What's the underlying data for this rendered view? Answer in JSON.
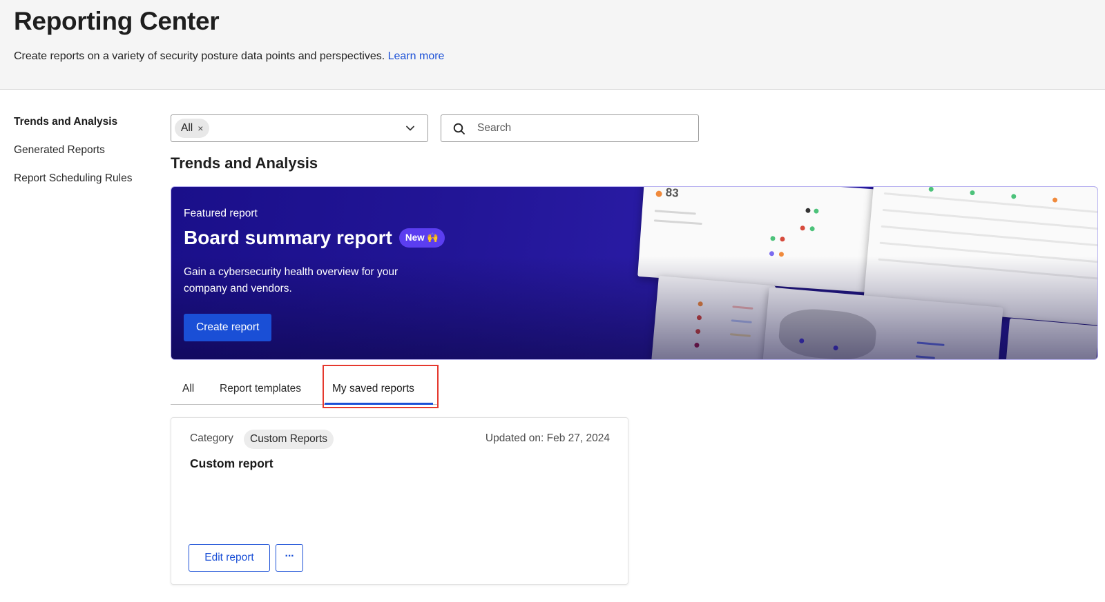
{
  "header": {
    "title": "Reporting Center",
    "description": "Create reports on a variety of security posture data points and perspectives.",
    "learn_more": "Learn more"
  },
  "sidebar": {
    "items": [
      {
        "label": "Trends and Analysis",
        "active": true
      },
      {
        "label": "Generated Reports",
        "active": false
      },
      {
        "label": "Report Scheduling Rules",
        "active": false
      }
    ]
  },
  "filter": {
    "chip_label": "All",
    "chip_remove": "×"
  },
  "search": {
    "placeholder": "Search",
    "icon": "search-icon"
  },
  "section_title": "Trends and Analysis",
  "banner": {
    "label": "Featured report",
    "title": "Board summary report",
    "badge": "New 🙌",
    "description": "Gain a cybersecurity health overview for your company and vendors.",
    "cta": "Create report",
    "preview_score": "83"
  },
  "tabs": {
    "items": [
      {
        "label": "All",
        "active": false
      },
      {
        "label": "Report templates",
        "active": false
      },
      {
        "label": "My saved reports",
        "active": true
      }
    ]
  },
  "card": {
    "category_label": "Category",
    "category_value": "Custom Reports",
    "updated": "Updated on: Feb 27, 2024",
    "title": "Custom report",
    "edit_label": "Edit report",
    "more_label": "···"
  },
  "colors": {
    "accent": "#1a4fd6",
    "banner": "#221596",
    "badge": "#5b3ef0",
    "highlight": "#e5382d"
  }
}
